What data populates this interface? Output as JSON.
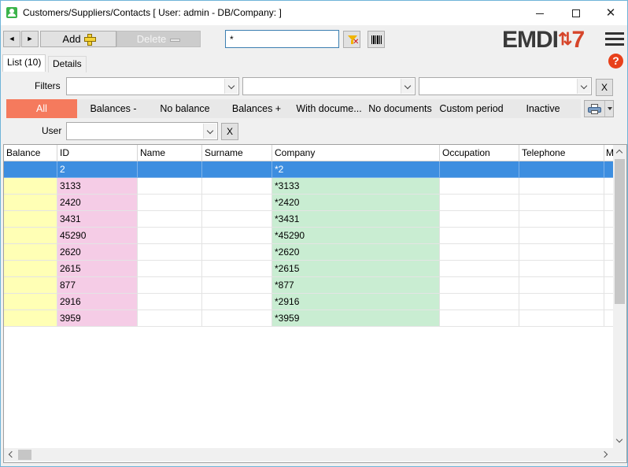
{
  "window": {
    "title": "Customers/Suppliers/Contacts   [ User: admin - DB/Company: ]",
    "minimize_glyph": "",
    "close_glyph": "✕"
  },
  "toolbar": {
    "prev_glyph": "◄",
    "next_glyph": "►",
    "add_label": "Add",
    "delete_label": "Delete",
    "search_value": "*",
    "search_placeholder": ""
  },
  "logo": {
    "text_main": "EMDI",
    "text_arrows": "⇅",
    "text_version": "7"
  },
  "help_glyph": "?",
  "tabs": [
    {
      "label": "List (10)",
      "active": true
    },
    {
      "label": "Details",
      "active": false
    }
  ],
  "filters": {
    "label": "Filters",
    "clear_label": "X"
  },
  "segments": [
    {
      "label": "All",
      "active": true
    },
    {
      "label": "Balances -",
      "active": false
    },
    {
      "label": "No balance",
      "active": false
    },
    {
      "label": "Balances +",
      "active": false
    },
    {
      "label": "With docume...",
      "active": false
    },
    {
      "label": "No documents",
      "active": false
    },
    {
      "label": "Custom period",
      "active": false
    },
    {
      "label": "Inactive",
      "active": false
    }
  ],
  "user_filter": {
    "label": "User",
    "clear_label": "X"
  },
  "grid": {
    "columns": [
      "Balance",
      "ID",
      "Name",
      "Surname",
      "Company",
      "Occupation",
      "Telephone",
      "M"
    ],
    "rows": [
      {
        "balance": "",
        "id": "2",
        "name": "",
        "surname": "",
        "company": "*2",
        "occupation": "",
        "telephone": "",
        "selected": true
      },
      {
        "balance": "",
        "id": "3133",
        "name": "",
        "surname": "",
        "company": "*3133",
        "occupation": "",
        "telephone": "",
        "selected": false
      },
      {
        "balance": "",
        "id": "2420",
        "name": "",
        "surname": "",
        "company": "*2420",
        "occupation": "",
        "telephone": "",
        "selected": false
      },
      {
        "balance": "",
        "id": "3431",
        "name": "",
        "surname": "",
        "company": "*3431",
        "occupation": "",
        "telephone": "",
        "selected": false
      },
      {
        "balance": "",
        "id": "45290",
        "name": "",
        "surname": "",
        "company": "*45290",
        "occupation": "",
        "telephone": "",
        "selected": false
      },
      {
        "balance": "",
        "id": "2620",
        "name": "",
        "surname": "",
        "company": "*2620",
        "occupation": "",
        "telephone": "",
        "selected": false
      },
      {
        "balance": "",
        "id": "2615",
        "name": "",
        "surname": "",
        "company": "*2615",
        "occupation": "",
        "telephone": "",
        "selected": false
      },
      {
        "balance": "",
        "id": "877",
        "name": "",
        "surname": "",
        "company": "*877",
        "occupation": "",
        "telephone": "",
        "selected": false
      },
      {
        "balance": "",
        "id": "2916",
        "name": "",
        "surname": "",
        "company": "*2916",
        "occupation": "",
        "telephone": "",
        "selected": false
      },
      {
        "balance": "",
        "id": "3959",
        "name": "",
        "surname": "",
        "company": "*3959",
        "occupation": "",
        "telephone": "",
        "selected": false
      }
    ]
  },
  "colors": {
    "accent_active_segment": "#f57a5d",
    "selected_row": "#3d8ee0",
    "balance_column": "#ffffb5",
    "id_column": "#f5cce6",
    "company_column": "#c9edd2"
  }
}
